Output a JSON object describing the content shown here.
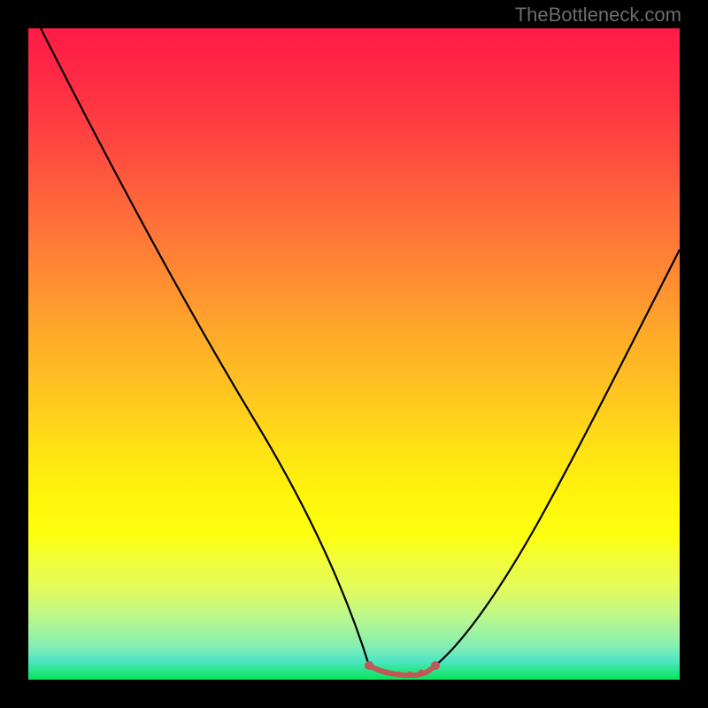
{
  "attribution": "TheBottleneck.com",
  "chart_data": {
    "type": "line",
    "title": "",
    "xlabel": "",
    "ylabel": "",
    "xlim": [
      0,
      100
    ],
    "ylim": [
      0,
      100
    ],
    "grid": false,
    "background": "rainbow-gradient-vertical",
    "series": [
      {
        "name": "left-curve",
        "color": "#000000",
        "x": [
          2,
          10,
          20,
          30,
          40,
          48,
          52
        ],
        "y": [
          100,
          83,
          62,
          42,
          23,
          6,
          1
        ]
      },
      {
        "name": "right-curve",
        "color": "#000000",
        "x": [
          62,
          66,
          72,
          80,
          88,
          96,
          100
        ],
        "y": [
          1,
          4,
          12,
          26,
          42,
          58,
          66
        ]
      },
      {
        "name": "bottom-segment",
        "color": "#c05858",
        "marker": true,
        "x": [
          52,
          54,
          56,
          58,
          60,
          62
        ],
        "y": [
          1,
          0.5,
          0.3,
          0.3,
          0.5,
          1
        ]
      }
    ],
    "gradient_stops": [
      {
        "pos": 0,
        "color": "#ff1b46"
      },
      {
        "pos": 50,
        "color": "#ffb020"
      },
      {
        "pos": 78,
        "color": "#fcff10"
      },
      {
        "pos": 100,
        "color": "#07e45a"
      }
    ]
  }
}
